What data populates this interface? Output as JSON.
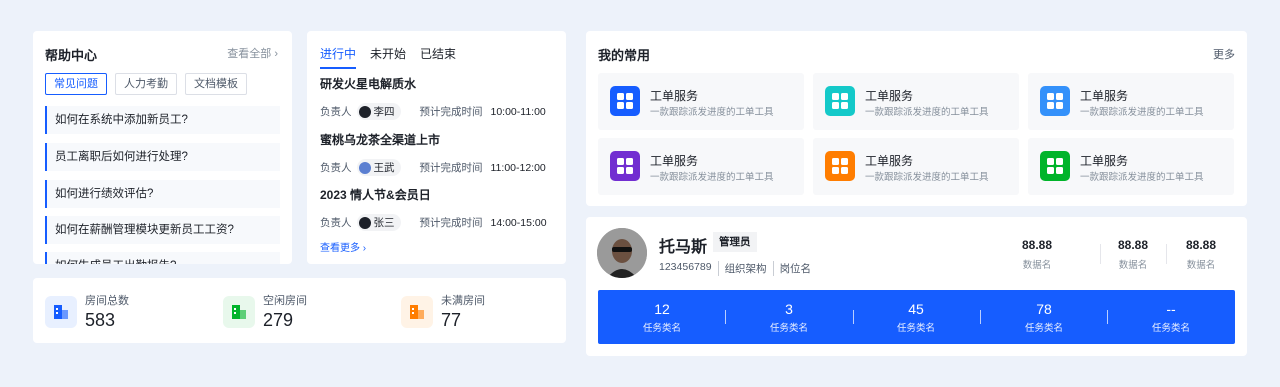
{
  "help": {
    "title": "帮助中心",
    "view_all": "查看全部 ›",
    "tags": [
      "常见问题",
      "人力考勤",
      "文档模板"
    ],
    "faqs": [
      "如何在系统中添加新员工?",
      "员工离职后如何进行处理?",
      "如何进行绩效评估?",
      "如何在薪酬管理模块更新员工工资?",
      "如何生成员工出勤报告?"
    ]
  },
  "tasks": {
    "tabs": [
      "进行中",
      "未开始",
      "已结束"
    ],
    "owner_label": "负责人",
    "due_label": "预计完成时间",
    "items": [
      {
        "name": "研发火星电解质水",
        "owner": "李四",
        "time": "10:00-11:00"
      },
      {
        "name": "蜜桃乌龙茶全渠道上市",
        "owner": "王武",
        "time": "11:00-12:00"
      },
      {
        "name": "2023 情人节&会员日",
        "owner": "张三",
        "time": "14:00-15:00"
      }
    ],
    "view_more": "查看更多 ›"
  },
  "rooms": [
    {
      "label": "房间总数",
      "value": "583",
      "color": "#165dff",
      "bg": "#e8f0ff"
    },
    {
      "label": "空闲房间",
      "value": "279",
      "color": "#00b42a",
      "bg": "#e8f8ec"
    },
    {
      "label": "未满房间",
      "value": "77",
      "color": "#ff7d00",
      "bg": "#fff3e6"
    }
  ],
  "favorites": {
    "title": "我的常用",
    "more": "更多",
    "apps": [
      {
        "name": "工单服务",
        "desc": "一款跟踪派发进度的工单工具",
        "color": "#165dff"
      },
      {
        "name": "工单服务",
        "desc": "一款跟踪派发进度的工单工具",
        "color": "#14c9c9"
      },
      {
        "name": "工单服务",
        "desc": "一款跟踪派发进度的工单工具",
        "color": "#3491fa"
      },
      {
        "name": "工单服务",
        "desc": "一款跟踪派发进度的工单工具",
        "color": "#722ed1"
      },
      {
        "name": "工单服务",
        "desc": "一款跟踪派发进度的工单工具",
        "color": "#ff7d00"
      },
      {
        "name": "工单服务",
        "desc": "一款跟踪派发进度的工单工具",
        "color": "#00b42a"
      }
    ]
  },
  "profile": {
    "name": "托马斯",
    "role": "管理员",
    "id": "123456789",
    "org": "组织架构",
    "position": "岗位名",
    "stats": [
      {
        "value": "88.88",
        "label": "数据名"
      },
      {
        "value": "88.88",
        "label": "数据名"
      },
      {
        "value": "88.88",
        "label": "数据名"
      }
    ],
    "bar": [
      {
        "value": "12",
        "label": "任务类名"
      },
      {
        "value": "3",
        "label": "任务类名"
      },
      {
        "value": "45",
        "label": "任务类名"
      },
      {
        "value": "78",
        "label": "任务类名"
      },
      {
        "value": "--",
        "label": "任务类名"
      }
    ]
  },
  "colors": {
    "accent": "#165dff",
    "background": "#edf2fa"
  }
}
